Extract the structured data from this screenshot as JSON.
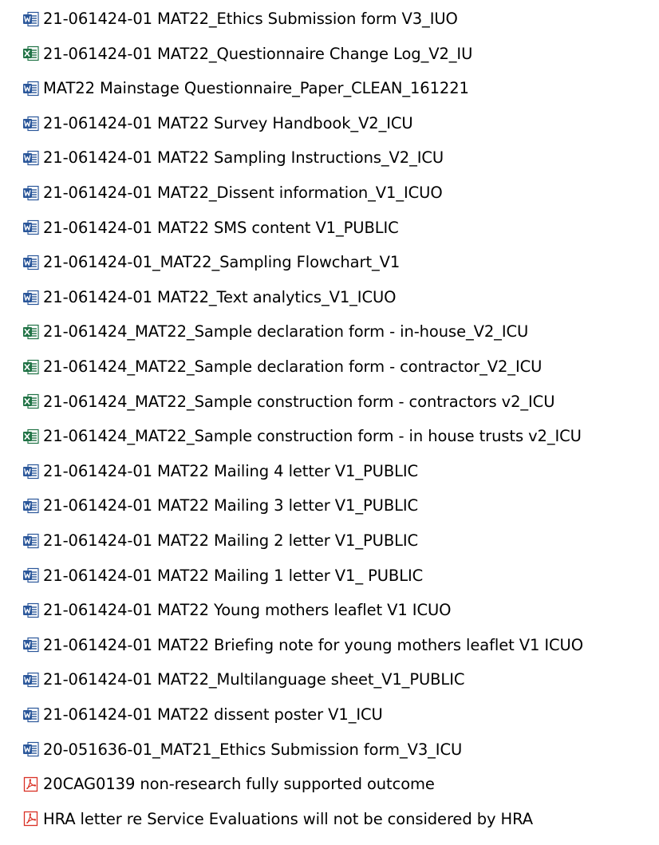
{
  "colors": {
    "word": "#2b579a",
    "excel": "#217346",
    "pdf": "#d93025",
    "text": "#000000",
    "background": "#ffffff"
  },
  "files": [
    {
      "type": "word",
      "icon": "word-document-icon",
      "name": "21-061424-01 MAT22_Ethics Submission form V3_IUO"
    },
    {
      "type": "excel",
      "icon": "excel-spreadsheet-icon",
      "name": "21-061424-01 MAT22_Questionnaire Change Log_V2_IU"
    },
    {
      "type": "word",
      "icon": "word-document-icon",
      "name": "MAT22 Mainstage Questionnaire_Paper_CLEAN_161221"
    },
    {
      "type": "word",
      "icon": "word-document-icon",
      "name": "21-061424-01 MAT22 Survey Handbook_V2_ICU"
    },
    {
      "type": "word",
      "icon": "word-document-icon",
      "name": "21-061424-01 MAT22 Sampling Instructions_V2_ICU"
    },
    {
      "type": "word",
      "icon": "word-document-icon",
      "name": "21-061424-01 MAT22_Dissent information_V1_ICUO"
    },
    {
      "type": "word",
      "icon": "word-document-icon",
      "name": "21-061424-01 MAT22 SMS content V1_PUBLIC"
    },
    {
      "type": "word",
      "icon": "word-document-icon",
      "name": "21-061424-01_MAT22_Sampling Flowchart_V1"
    },
    {
      "type": "word",
      "icon": "word-document-icon",
      "name": "21-061424-01 MAT22_Text analytics_V1_ICUO"
    },
    {
      "type": "excel",
      "icon": "excel-spreadsheet-icon",
      "name": "21-061424_MAT22_Sample declaration form - in-house_V2_ICU"
    },
    {
      "type": "excel",
      "icon": "excel-spreadsheet-icon",
      "name": "21-061424_MAT22_Sample declaration form - contractor_V2_ICU"
    },
    {
      "type": "excel",
      "icon": "excel-spreadsheet-icon",
      "name": "21-061424_MAT22_Sample construction form - contractors v2_ICU"
    },
    {
      "type": "excel",
      "icon": "excel-spreadsheet-icon",
      "name": "21-061424_MAT22_Sample construction form - in house trusts v2_ICU"
    },
    {
      "type": "word",
      "icon": "word-document-icon",
      "name": "21-061424-01 MAT22 Mailing 4 letter V1_PUBLIC"
    },
    {
      "type": "word",
      "icon": "word-document-icon",
      "name": "21-061424-01 MAT22 Mailing 3 letter V1_PUBLIC"
    },
    {
      "type": "word",
      "icon": "word-document-icon",
      "name": "21-061424-01 MAT22 Mailing 2 letter V1_PUBLIC"
    },
    {
      "type": "word",
      "icon": "word-document-icon",
      "name": "21-061424-01 MAT22 Mailing 1 letter V1_ PUBLIC"
    },
    {
      "type": "word",
      "icon": "word-document-icon",
      "name": "21-061424-01 MAT22 Young mothers leaflet V1 ICUO"
    },
    {
      "type": "word",
      "icon": "word-document-icon",
      "name": "21-061424-01 MAT22 Briefing note for young mothers leaflet V1 ICUO"
    },
    {
      "type": "word",
      "icon": "word-document-icon",
      "name": "21-061424-01 MAT22_Multilanguage sheet_V1_PUBLIC"
    },
    {
      "type": "word",
      "icon": "word-document-icon",
      "name": "21-061424-01 MAT22 dissent poster V1_ICU"
    },
    {
      "type": "word",
      "icon": "word-document-icon",
      "name": "20-051636-01_MAT21_Ethics Submission form_V3_ICU"
    },
    {
      "type": "pdf",
      "icon": "pdf-document-icon",
      "name": "20CAG0139 non-research fully supported outcome"
    },
    {
      "type": "pdf",
      "icon": "pdf-document-icon",
      "name": "HRA letter re Service Evaluations will not be considered by HRA"
    }
  ]
}
